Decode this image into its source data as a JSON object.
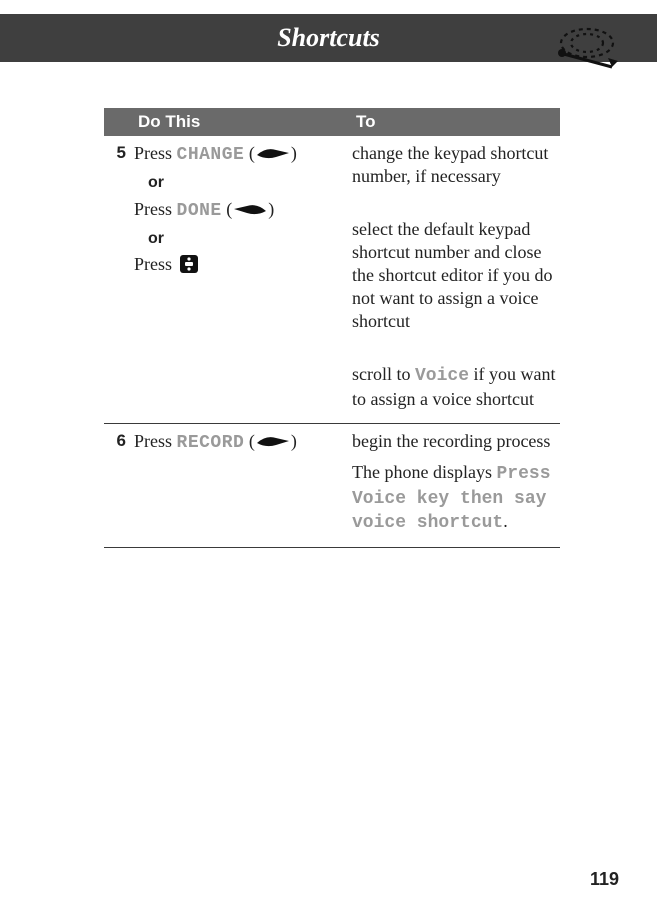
{
  "header": {
    "title": "Shortcuts"
  },
  "table": {
    "head": {
      "do": "Do This",
      "to": "To"
    },
    "rows": [
      {
        "num": "5",
        "actions": {
          "change": {
            "press": "Press ",
            "label": "CHANGE",
            "open": " (",
            "close": ")"
          },
          "or1": "or",
          "done": {
            "press": "Press ",
            "label": "DONE",
            "open": " (",
            "close": ")"
          },
          "or2": "or",
          "nav": {
            "press": "Press "
          }
        },
        "results": {
          "change": "change the keypad shortcut number, if necessary",
          "done": "select the default keypad shortcut number and close the shortcut editor if you do not want to assign a voice shortcut",
          "nav_pre": "scroll to ",
          "nav_voice": "Voice",
          "nav_post": " if you want to assign a voice shortcut"
        }
      },
      {
        "num": "6",
        "actions": {
          "record": {
            "press": "Press ",
            "label": "RECORD",
            "open": " (",
            "close": ")"
          }
        },
        "results": {
          "record": "begin the recording process",
          "msg_pre": "The phone displays ",
          "msg": "Press Voice key then say voice shortcut",
          "msg_post": "."
        }
      }
    ]
  },
  "page_number": "119"
}
